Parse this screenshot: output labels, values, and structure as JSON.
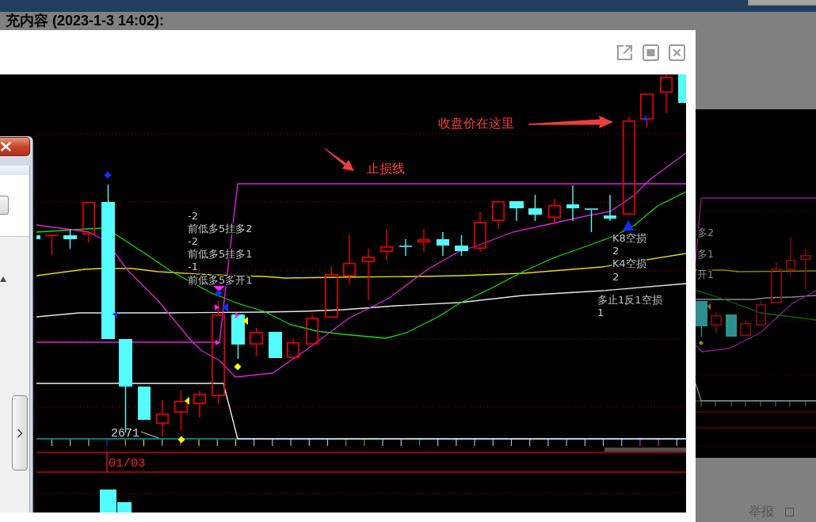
{
  "page": {
    "heading": "充内容 (2023-1-3 14:02):",
    "footer_links": [
      "举报"
    ]
  },
  "background_chart": {
    "labels": [
      "多2",
      "多1",
      "开1"
    ]
  },
  "lightbox": {
    "chart": {
      "annotations": [
        {
          "text": "收盘价在这里"
        },
        {
          "text": "止损线"
        }
      ],
      "signal_groups": [
        {
          "lines": [
            "-2",
            "前低多5挂多2",
            "-2",
            "前低多5挂多1",
            "-1",
            "前低多5多开1"
          ]
        },
        {
          "lines": [
            "K8空损",
            "2",
            "K4空损",
            "2",
            "多止1反1空损",
            "1"
          ]
        }
      ],
      "low_price_label": "2671",
      "date_label": "01/03"
    }
  }
}
